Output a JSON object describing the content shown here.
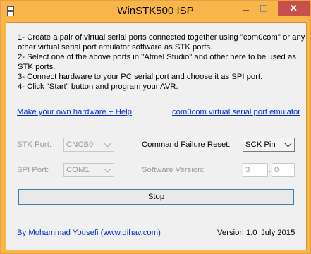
{
  "window": {
    "title": "WinSTK500 ISP",
    "close_glyph": "✕",
    "icon": "app-icon",
    "colors": {
      "title_bar": "#f7b54a",
      "close_button": "#c7504b",
      "link": "#0033cc",
      "button_border": "#3c7fb1"
    }
  },
  "instructions": [
    "1- Create a pair of virtual serial ports connected together using \"com0com\" or any",
    "other virtual serial port emulator software as STK ports.",
    "2- Select one of the above ports in \"Atmel Studio\" and other here to be used as",
    "STK ports.",
    "3- Connect hardware to your PC serial port and choose it as SPI port.",
    "4- Click \"Start\" button and program your AVR."
  ],
  "links": {
    "make_hardware": "Make your own hardware + Help",
    "com0com": "com0com virtual serial port emulator"
  },
  "stk_port": {
    "label": "STK Port:",
    "value": "CNCB0"
  },
  "spi_port": {
    "label": "SPI Port:",
    "value": "COM1"
  },
  "command_failure_reset": {
    "label": "Command Failure Reset:",
    "value": "SCK Pin"
  },
  "software_version": {
    "label": "Software Version:",
    "major": "3",
    "separator": ".",
    "minor": "0"
  },
  "stop_button": {
    "label": "Stop"
  },
  "footer": {
    "author_link": "By Mohammad Yousefi (www.dihav.com)",
    "version": "Version 1.0",
    "date": "July 2015"
  }
}
